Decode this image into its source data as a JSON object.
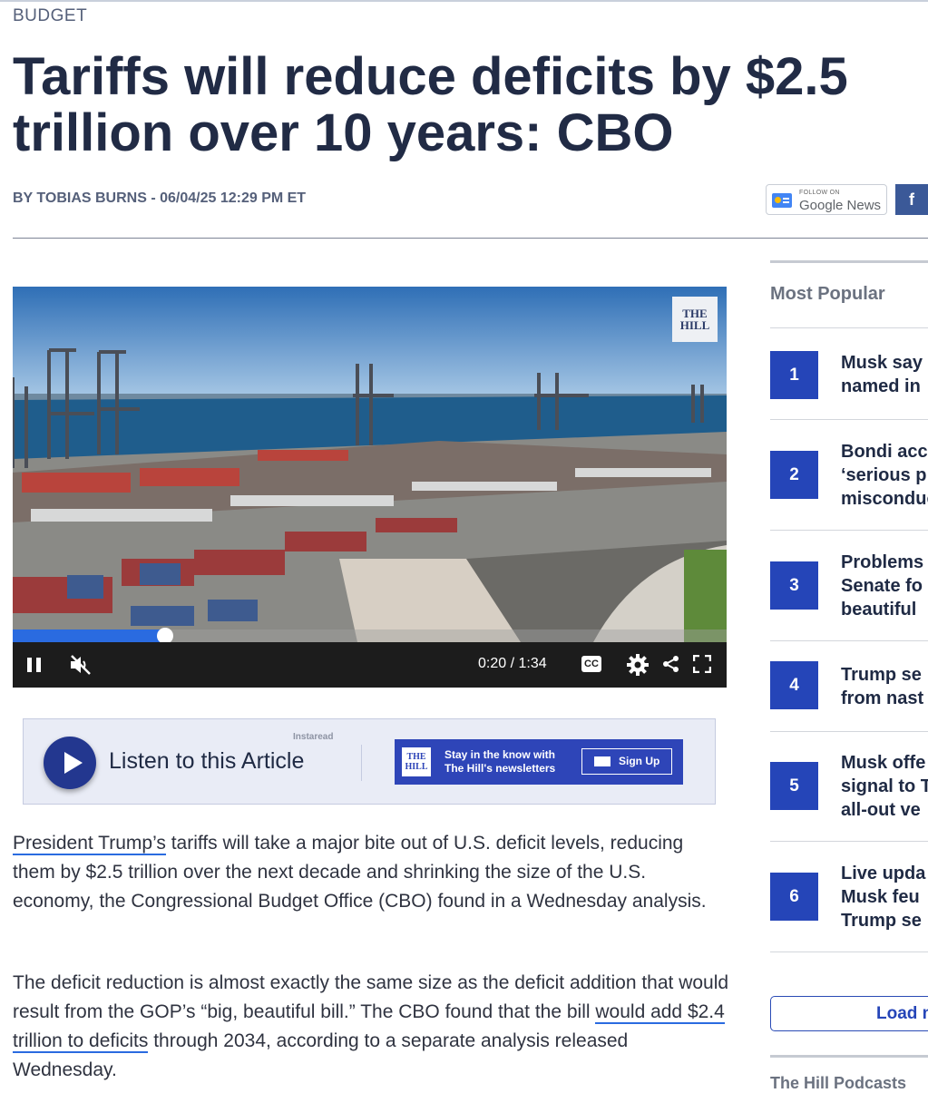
{
  "article": {
    "category": "BUDGET",
    "headline": "Tariffs will reduce deficits by $2.5 trillion over 10 years: CBO",
    "byline": "BY TOBIAS BURNS - 06/04/25 12:29 PM ET",
    "p1_link": "President Trump’s",
    "p1_rest": " tariffs will take a major bite out of U.S. deficit levels, reducing them by $2.5 trillion over the next decade and shrinking the size of the U.S. economy, the Congressional Budget Office (CBO) found in a Wednesday analysis.",
    "p2_start": "The deficit reduction is almost exactly the same size as the deficit addition that would result from the GOP’s “big, beautiful bill.” The CBO found that the bill ",
    "p2_link": "would add $2.4 trillion to deficits",
    "p2_end": " through 2034, according to a separate analysis released Wednesday."
  },
  "share": {
    "gnews_small": "FOLLOW ON",
    "gnews_label": "Google News",
    "facebook": "f"
  },
  "video": {
    "badge": "THE HILL",
    "current_time": "0:20",
    "duration": "/ 1:34",
    "progress": 0.213,
    "cc_label": "CC",
    "icons": [
      "pause-icon",
      "mute-icon",
      "cc-icon",
      "gear-icon",
      "share-icon",
      "fullscreen-icon"
    ]
  },
  "listen": {
    "label": "Listen to this Article",
    "brand": "Instaread",
    "newsletter_logo": "THE HILL",
    "newsletter_text": "Stay in the know with The Hill's newsletters",
    "signup_label": "Sign Up"
  },
  "sidebar": {
    "title": "Most Popular",
    "items": [
      {
        "rank": "1",
        "title": "Musk say\nnamed in"
      },
      {
        "rank": "2",
        "title": "Bondi acc\n‘serious p\nmisconduc"
      },
      {
        "rank": "3",
        "title": "Problems\nSenate fo\nbeautiful"
      },
      {
        "rank": "4",
        "title": "Trump se\nfrom nast"
      },
      {
        "rank": "5",
        "title": "Musk offe\nsignal to T\nall-out ve"
      },
      {
        "rank": "6",
        "title": "Live upda\nMusk feu\nTrump se"
      }
    ],
    "load_more": "Load m",
    "podcasts": "The Hill Podcasts"
  },
  "colors": {
    "accent": "#2545b8",
    "link_underline": "#2a6be0",
    "headline": "#212b45"
  }
}
